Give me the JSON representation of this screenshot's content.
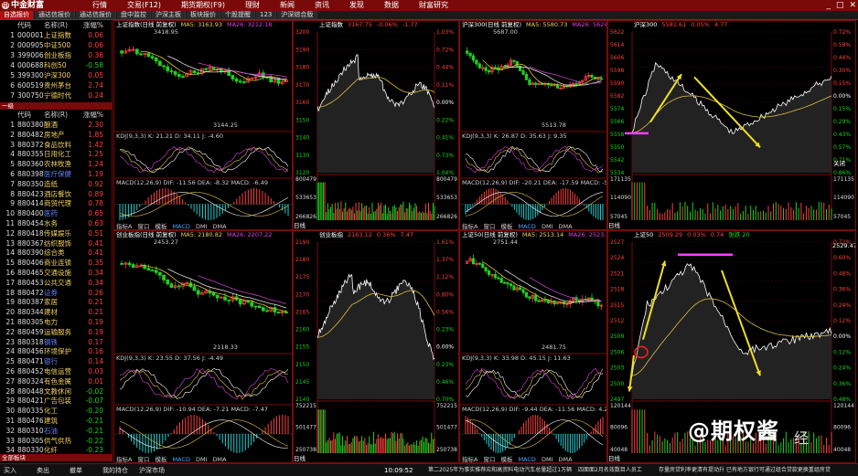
{
  "topbar": {
    "logo": "中金财富",
    "menu": [
      "行情",
      "交易(F12)",
      "期货期权(F9)",
      "理财",
      "新闻",
      "资讯",
      "发现",
      "数据",
      "财富研究"
    ],
    "window_buttons": [
      "_",
      "□",
      "✕"
    ]
  },
  "tabs": [
    "自选报价",
    "通达信报价",
    "通达信报价",
    "盘中监控",
    "沪深主板",
    "板块报价",
    "个股提醒",
    "123",
    "沪深综合版"
  ],
  "left": {
    "header": {
      "no": "",
      "code": "代码",
      "name": "名称(R)",
      "pct": "涨幅%"
    },
    "indices": [
      {
        "no": "1",
        "code": "000001",
        "name": "上证指数",
        "pct": "0.06"
      },
      {
        "no": "2",
        "code": "000905",
        "name": "中证500",
        "pct": "0.06"
      },
      {
        "no": "3",
        "code": "399006",
        "name": "创业板指",
        "pct": "0.36"
      },
      {
        "no": "4",
        "code": "000688",
        "name": "科创50",
        "pct": "-0.58"
      },
      {
        "no": "5",
        "code": "399300",
        "name": "沪深300",
        "pct": "0.05"
      },
      {
        "no": "6",
        "code": "600519",
        "name": "贵州茅台",
        "pct": "2.74"
      },
      {
        "no": "7",
        "code": "300750",
        "name": "宁德时代",
        "pct": "0.24"
      }
    ],
    "section_label": "一级",
    "header2": {
      "no": "",
      "code": "代码",
      "name": "名称(R)",
      "pct": "涨幅%"
    },
    "sectors": [
      {
        "no": "1",
        "code": "880380",
        "name": "酿酒",
        "pct": "2.30"
      },
      {
        "no": "2",
        "code": "880482",
        "name": "房地产",
        "pct": "1.85"
      },
      {
        "no": "3",
        "code": "880372",
        "name": "食品饮料",
        "pct": "1.42"
      },
      {
        "no": "4",
        "code": "880355",
        "name": "日用化工",
        "pct": "1.25"
      },
      {
        "no": "5",
        "code": "880360",
        "name": "农林牧渔",
        "pct": "1.24"
      },
      {
        "no": "6",
        "code": "880398",
        "name": "医疗保健",
        "pct": "1.19"
      },
      {
        "no": "7",
        "code": "880350",
        "name": "造纸",
        "pct": "0.92"
      },
      {
        "no": "8",
        "code": "880423",
        "name": "酒店餐饮",
        "pct": "0.89"
      },
      {
        "no": "9",
        "code": "880414",
        "name": "商贸代理",
        "pct": "0.78"
      },
      {
        "no": "10",
        "code": "880400",
        "name": "医药",
        "pct": "0.65"
      },
      {
        "no": "11",
        "code": "880454",
        "name": "水务",
        "pct": "0.63"
      },
      {
        "no": "12",
        "code": "880418",
        "name": "传媒娱乐",
        "pct": "0.51"
      },
      {
        "no": "13",
        "code": "880367",
        "name": "纺织服饰",
        "pct": "0.41"
      },
      {
        "no": "14",
        "code": "880390",
        "name": "综合类",
        "pct": "0.41"
      },
      {
        "no": "15",
        "code": "880406",
        "name": "商业连锁",
        "pct": "0.35"
      },
      {
        "no": "16",
        "code": "880465",
        "name": "交通设施",
        "pct": "0.34"
      },
      {
        "no": "17",
        "code": "880453",
        "name": "公共交通",
        "pct": "0.34"
      },
      {
        "no": "18",
        "code": "880472",
        "name": "证券",
        "pct": "0.26"
      },
      {
        "no": "19",
        "code": "880387",
        "name": "家居",
        "pct": "0.21"
      },
      {
        "no": "20",
        "code": "880344",
        "name": "建材",
        "pct": "0.21"
      },
      {
        "no": "21",
        "code": "880305",
        "name": "电力",
        "pct": "0.19"
      },
      {
        "no": "22",
        "code": "880459",
        "name": "运输服务",
        "pct": "0.19"
      },
      {
        "no": "23",
        "code": "880318",
        "name": "钢铁",
        "pct": "0.17"
      },
      {
        "no": "24",
        "code": "880456",
        "name": "环境保护",
        "pct": "0.16"
      },
      {
        "no": "25",
        "code": "880471",
        "name": "银行",
        "pct": "0.14"
      },
      {
        "no": "26",
        "code": "880452",
        "name": "电信运营",
        "pct": "0.03"
      },
      {
        "no": "27",
        "code": "880324",
        "name": "有色金属",
        "pct": "0.01"
      },
      {
        "no": "28",
        "code": "880448",
        "name": "文教休闲",
        "pct": "-0.02"
      },
      {
        "no": "29",
        "code": "880421",
        "name": "广告包装",
        "pct": "-0.07"
      },
      {
        "no": "30",
        "code": "880335",
        "name": "化工",
        "pct": "-0.20"
      },
      {
        "no": "31",
        "code": "880476",
        "name": "建筑",
        "pct": "-0.21"
      },
      {
        "no": "32",
        "code": "880310",
        "name": "石油",
        "pct": "-0.21"
      },
      {
        "no": "33",
        "code": "880305",
        "name": "供气供热",
        "pct": "-0.22"
      },
      {
        "no": "34",
        "code": "880330",
        "name": "化纤",
        "pct": "-0.23"
      }
    ],
    "bottom_tag": "全部板块"
  },
  "panels": {
    "sh_kline": {
      "title": "上证指数(日线 前复权)",
      "ma5": "MA5: 3163.93",
      "ma26": "MA26: 3212.18",
      "high": "3418.95",
      "low": "3144.25",
      "kdj": "KDJ(9,3,3)  K: 21.21  D: 34.11  J: -4.60",
      "macd": "MACD(12,26,9)  DIF: -11.56  DEA: -8.32  MACD: -6.49"
    },
    "sh_tline": {
      "title": "上证指数",
      "price": "3167.75",
      "chg": "-0.06%",
      "chg2": "-1.77",
      "yaxis": [
        "3200",
        "3190",
        "3180",
        "3170",
        "3160",
        "3150",
        "3140",
        "3130",
        "3120"
      ],
      "pct": [
        "1.03%",
        "0.72%",
        "0.44%",
        "0.11%",
        "0.00%",
        "0.22%",
        "0.41%",
        "0.73%",
        "1.04%"
      ],
      "vol_top": "800479",
      "vol_mid": "533653",
      "vol_low": "266826"
    },
    "hs300_kline": {
      "title": "沪深300(日线 前复权)",
      "ma5": "MA5: 5580.73",
      "ma26": "MA26: 5624.53",
      "high": "5687.00",
      "low": "5513.78",
      "kdj": "KDJ(9,3,3)  K: 26.87  D: 35.63  J: 9.35",
      "macd": "MACD(12,26,9)  DIF: -20.21  DEA: -17.59  MACD: -5.25"
    },
    "hs300_tline": {
      "title": "沪深300",
      "price": "5581.61",
      "chg": "0.05%",
      "chg2": "4.77",
      "yaxis": [
        "5622",
        "5614",
        "5606",
        "5598",
        "5590",
        "5582",
        "5574",
        "5566",
        "5558",
        "5550",
        "5542",
        "5534"
      ],
      "pct": [
        "0.72%",
        "0.58%",
        "0.44%",
        "0.30%",
        "0.15%",
        "0.00%",
        "0.15%",
        "0.29%",
        "0.43%",
        "0.57%",
        "0.71%",
        "0.86%"
      ],
      "vol_top": "171135",
      "vol_mid": "114090",
      "vol_low": "57045",
      "label": "关闭"
    },
    "cyb_kline": {
      "title": "创业板指(日线 前复权)",
      "ma5": "MA5: 2180.82",
      "ma26": "MA26: 2207.22",
      "high": "2453.27",
      "low": "2118.33",
      "kdj": "KDJ(9,3,3)  K: 23.55  D: 37.56  J: -4.49",
      "macd": "MACD(12,26,9)  DIF: -10.94  DEA: -7.21  MACD: -7.47"
    },
    "cyb_tline": {
      "title": "创业板指",
      "price": "2163.12",
      "chg": "0.36%",
      "chg2": "7.47",
      "yaxis": [
        "2190",
        "2180",
        "2175",
        "2170",
        "2165",
        "2160",
        "2155",
        "2150",
        "2145",
        "2140"
      ],
      "pct": [
        "1.61%",
        "1.37%",
        "1.12%",
        "0.80%",
        "0.56%",
        "0.23%",
        "0.00%",
        "0.23%",
        "0.46%",
        "0.70%"
      ],
      "vol_top": "752215",
      "vol_mid": "501477",
      "vol_low": "250738"
    },
    "sz50_kline": {
      "title": "上证50(日线 前复权)",
      "ma5": "MA5: 2513.14",
      "ma26": "MA26: 2523.61",
      "high": "2751.44",
      "low": "2481.75",
      "kdj": "KDJ(9,3,3)  K: 33.98  D: 45.15  J: 11.63",
      "macd": "MACD(12,26,9)  DIF: -9.44  DEA: -11.56  MACD: 4.24"
    },
    "sz50_tline": {
      "title": "上证50",
      "price": "2509.29",
      "chg": "0.03%",
      "chg2": "0.74",
      "extra": "张跌 20",
      "yaxis": [
        "2527",
        "2524",
        "2521",
        "2518",
        "2515",
        "2512",
        "2509",
        "2506",
        "2503",
        "2500",
        "2497"
      ],
      "pct": [
        "0.72%",
        "0.60%",
        "0.48%",
        "0.36%",
        "0.24%",
        "0.12%",
        "0.00%",
        "0.12%",
        "0.24%",
        "0.36%",
        "0.48%"
      ],
      "vol_top": "120144",
      "vol_mid": "80096",
      "vol_low": "40048",
      "price_tag": "2529.47"
    },
    "sub_tabs": [
      "指标A",
      "窗口",
      "模板",
      "MACD",
      "DMI",
      "DMA"
    ],
    "tline_tab": "日线"
  },
  "status": {
    "items": [
      "买入",
      "卖出",
      "撤单",
      "我的持仓",
      "沪深市场"
    ],
    "ticker1": "第二2025年为事实推荐应和高资料电动汽车总量超过1万辆",
    "ticker2": "四面面2月名效数目人员工",
    "ticker3": "存量房贷利率更清有提动升 已有地方银行可通过组合贷款更换重组房贷",
    "time": "10:09:52"
  },
  "watermark": "@期权酱",
  "watermark2": "经",
  "colors": {
    "up": "#ff4040",
    "down": "#20d020",
    "frame": "#7a0a0a",
    "accent": "#b01010",
    "ma_yellow": "#e0c040",
    "ma_magenta": "#c040c0",
    "annot_yellow": "#f0e020",
    "annot_magenta": "#ff40ff"
  }
}
